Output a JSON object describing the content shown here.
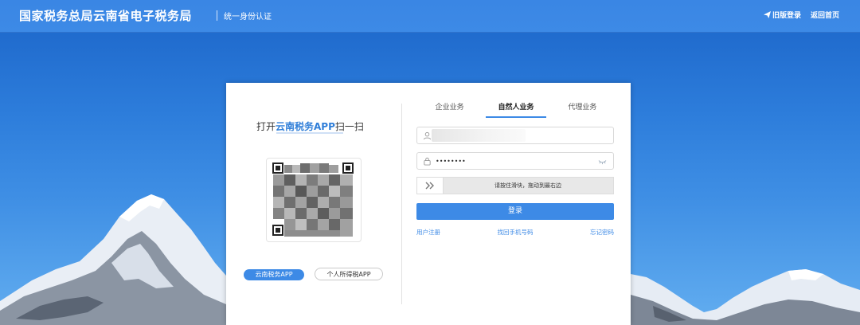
{
  "header": {
    "title": "国家税务总局云南省电子税务局",
    "subtitle": "统一身份认证",
    "links": [
      {
        "label": "旧版登录",
        "icon": "send-icon"
      },
      {
        "label": "返回首页",
        "icon": ""
      }
    ]
  },
  "qr_panel": {
    "scan_prefix": "打开",
    "scan_app": "云南税务APP",
    "scan_suffix": "扫一扫",
    "buttons": [
      {
        "label": "云南税务APP",
        "selected": true
      },
      {
        "label": "个人所得税APP",
        "selected": false
      }
    ]
  },
  "login_panel": {
    "tabs": [
      {
        "label": "企业业务",
        "active": false
      },
      {
        "label": "自然人业务",
        "active": true
      },
      {
        "label": "代理业务",
        "active": false
      }
    ],
    "username": {
      "value": "",
      "icon": "user-icon"
    },
    "password": {
      "value": "••••••••",
      "icon": "lock-icon"
    },
    "slider_text": "请按住滑块，拖动到最右边",
    "login_label": "登录",
    "links": {
      "register": "用户注册",
      "recover_phone": "找回手机号码",
      "forgot_password": "忘记密码"
    }
  },
  "colors": {
    "primary": "#3d8ae6",
    "header": "#3a86e4",
    "sky_top": "#1b64c8",
    "sky_bottom": "#63aef0"
  }
}
